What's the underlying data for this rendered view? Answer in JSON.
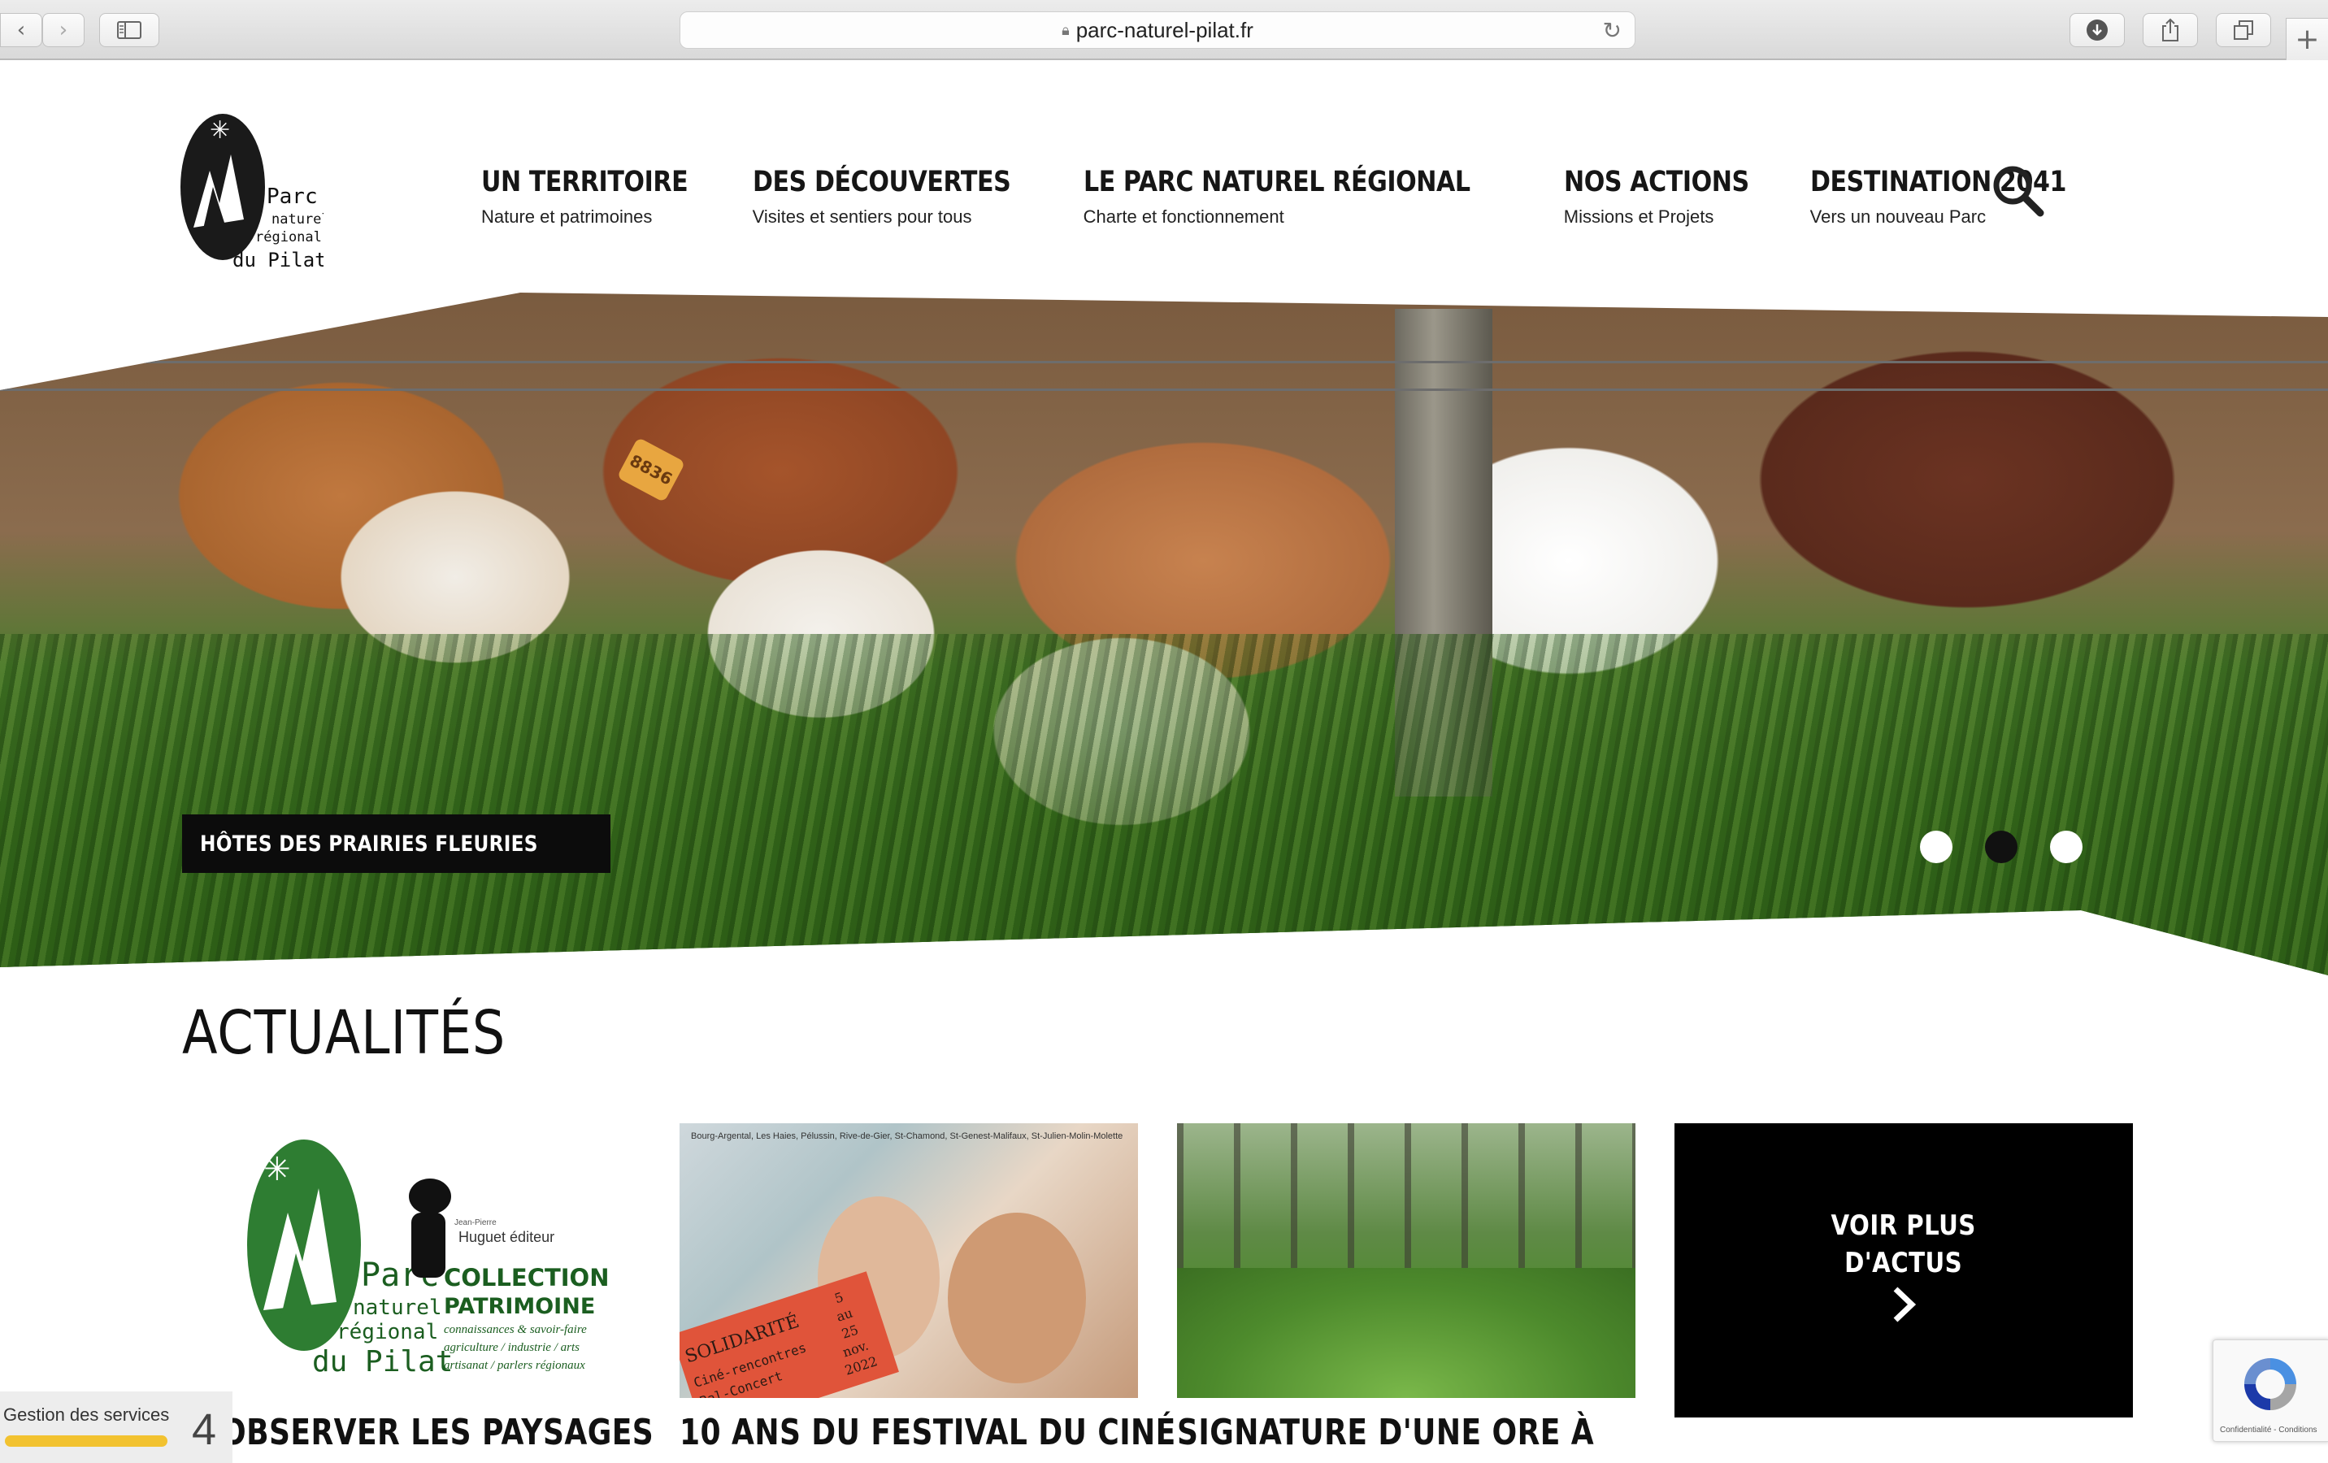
{
  "browser": {
    "url": "parc-naturel-pilat.fr"
  },
  "header": {
    "logo_text": [
      "Parc",
      "naturel",
      "régional",
      "du Pilat"
    ],
    "nav": [
      {
        "title": "UN TERRITOIRE",
        "subtitle": "Nature et patrimoines"
      },
      {
        "title": "DES DÉCOUVERTES",
        "subtitle": "Visites et sentiers pour tous"
      },
      {
        "title": "LE PARC NATUREL RÉGIONAL",
        "subtitle": "Charte et fonctionnement"
      },
      {
        "title": "NOS ACTIONS",
        "subtitle": "Missions et Projets"
      },
      {
        "title": "DESTINATION 2041",
        "subtitle": "Vers un nouveau Parc"
      }
    ]
  },
  "hero": {
    "caption": "HÔTES DES PRAIRIES FLEURIES",
    "slides": 3,
    "active_slide": 2,
    "ear_tag": "8836"
  },
  "news": {
    "title": "ACTUALITÉS",
    "cards": [
      {
        "title": "OBSERVER LES PAYSAGES",
        "image_text": [
          "Parc",
          "naturel",
          "régional",
          "du Pilat",
          "Jean-Pierre",
          "Huguet éditeur",
          "COLLECTION",
          "PATRIMOINE",
          "connaissances & savoir-faire",
          "agriculture / industrie / arts",
          "artisanat / parlers régionaux"
        ]
      },
      {
        "title": "10 ANS DU FESTIVAL DU CINÉ",
        "image_text": [
          "Bourg-Argental, Les Haies, Pélussin, Rive-de-Gier, St-Chamond, St-Genest-Malifaux, St-Julien-Molin-Molette",
          "SOLIDARITÉ",
          "Ciné-rencontres",
          "Bal-Concert",
          "5",
          "au",
          "25",
          "nov.",
          "2022"
        ]
      },
      {
        "title": "SIGNATURE D'UNE ORE À",
        "image_text": []
      }
    ],
    "more_label_line1": "VOIR PLUS",
    "more_label_line2": "D'ACTUS"
  },
  "cookie_widget": {
    "label": "Gestion des services",
    "count": "4"
  },
  "recaptcha": {
    "terms": "Confidentialité - Conditions"
  }
}
